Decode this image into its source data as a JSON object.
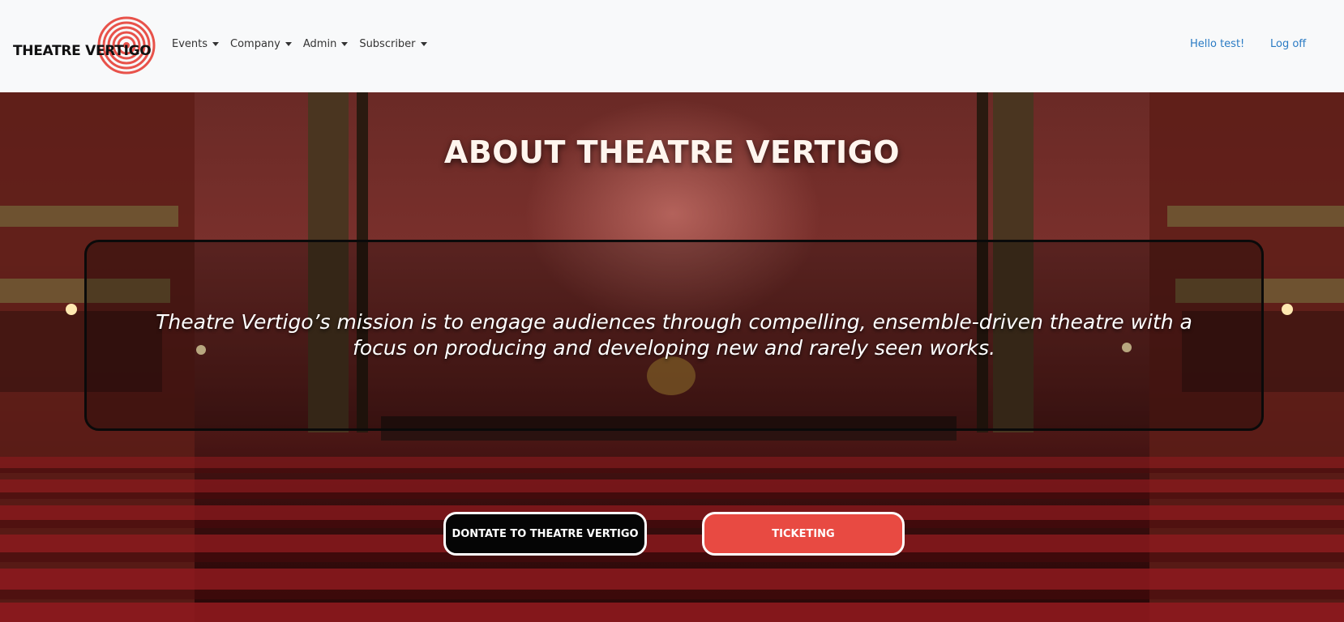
{
  "brand": {
    "name": "THEATRE VERTIGO",
    "logo_icon": "spiral-logo-icon",
    "logo_color": "#e8524a"
  },
  "nav": {
    "items": [
      {
        "label": "Events"
      },
      {
        "label": "Company"
      },
      {
        "label": "Admin"
      },
      {
        "label": "Subscriber"
      }
    ],
    "greeting": "Hello test!",
    "logoff": "Log off",
    "link_color": "#2a7bc4"
  },
  "hero": {
    "title": "ABOUT THEATRE VERTIGO",
    "mission": "Theatre Vertigo’s mission is to engage audiences through compelling, ensemble-driven theatre with a focus on producing and developing new and rarely seen works.",
    "buttons": {
      "donate": "DONTATE TO THEATRE VERTIGO",
      "ticketing": "TICKETING"
    },
    "accent_color": "#e84a42"
  }
}
